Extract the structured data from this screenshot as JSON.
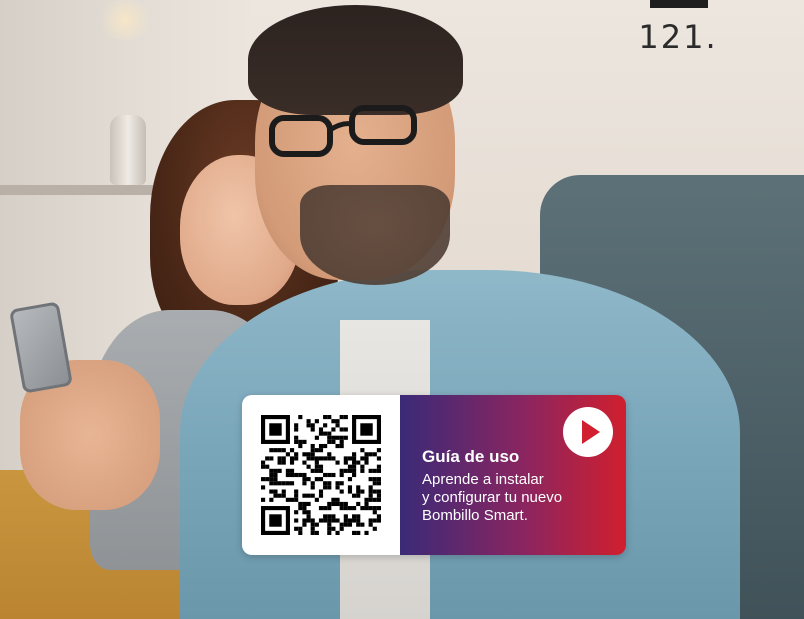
{
  "page": {
    "number": "121."
  },
  "guide": {
    "title": "Guía de uso",
    "description_lines": [
      "Aprende a instalar",
      "y configurar tu nuevo",
      "Bombillo Smart."
    ]
  },
  "colors": {
    "gradient_start": "#3a2a78",
    "gradient_mid": "#8b2560",
    "gradient_end": "#d01f2e"
  },
  "icons": {
    "play": "play-icon",
    "qr": "qr-code"
  }
}
